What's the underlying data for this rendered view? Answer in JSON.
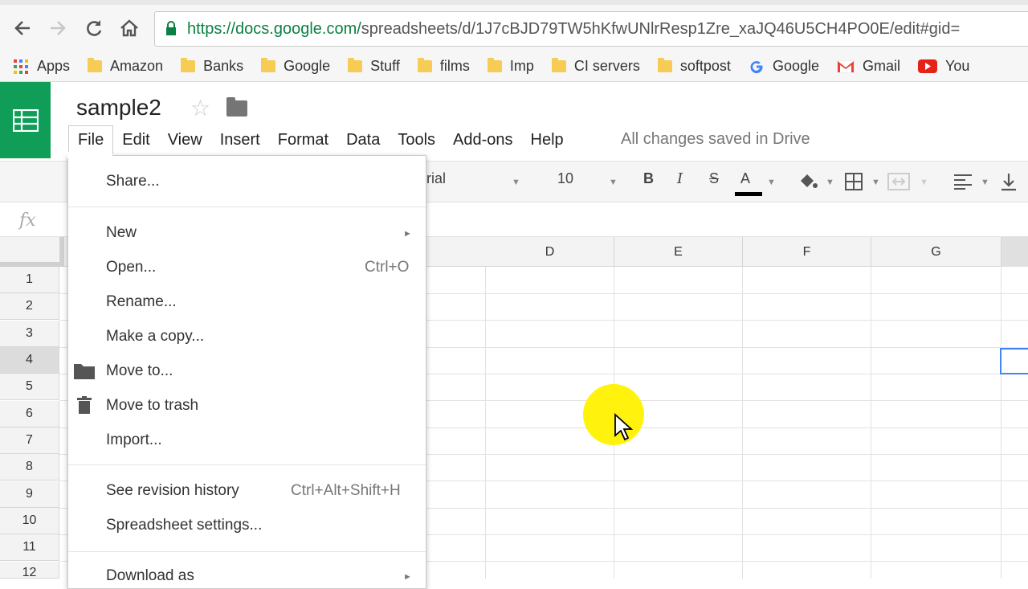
{
  "browser": {
    "url_secure": "https://docs.google.com/",
    "url_rest": "spreadsheets/d/1J7cBJD79TW5hKfwUNlrResp1Zre_xaJQ46U5CH4PO0E/edit#gid=",
    "bookmarks": [
      "Apps",
      "Amazon",
      "Banks",
      "Google",
      "Stuff",
      "films",
      "Imp",
      "CI servers",
      "softpost",
      "Google",
      "Gmail",
      "You"
    ]
  },
  "sheet": {
    "title": "sample2",
    "menus": [
      "File",
      "Edit",
      "View",
      "Insert",
      "Format",
      "Data",
      "Tools",
      "Add-ons",
      "Help"
    ],
    "status": "All changes saved in Drive",
    "font_name": "rial",
    "font_size": "10",
    "formula_label": "fx",
    "columns": [
      "D",
      "E",
      "F",
      "G"
    ],
    "rows": [
      "1",
      "2",
      "3",
      "4",
      "5",
      "6",
      "7",
      "8",
      "9",
      "10",
      "11",
      "12"
    ]
  },
  "file_menu": {
    "share": "Share...",
    "new": "New",
    "open": "Open...",
    "open_shortcut": "Ctrl+O",
    "rename": "Rename...",
    "copy": "Make a copy...",
    "move": "Move to...",
    "trash": "Move to trash",
    "import": "Import...",
    "revision": "See revision history",
    "revision_shortcut": "Ctrl+Alt+Shift+H",
    "settings": "Spreadsheet settings...",
    "download": "Download as"
  },
  "colors": {
    "brand_green": "#0f9d58",
    "selection_blue": "#4285f4",
    "cursor_highlight": "#fff200"
  }
}
